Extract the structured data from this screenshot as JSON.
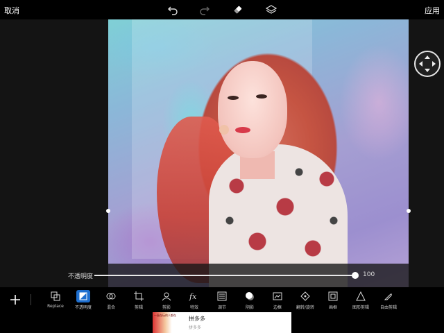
{
  "topbar": {
    "cancel_label": "取消",
    "apply_label": "应用",
    "icons": [
      "undo-icon",
      "redo-icon",
      "eraser-icon",
      "layers-icon"
    ]
  },
  "slider": {
    "label": "不透明度",
    "value": "100",
    "fraction": 1.0
  },
  "toolbar": {
    "add_icon": "plus-icon",
    "tools": [
      {
        "label": "Replace",
        "icon": "replace-icon",
        "active": false
      },
      {
        "label": "不透明度",
        "icon": "opacity-icon",
        "active": true
      },
      {
        "label": "混合",
        "icon": "blend-icon",
        "active": false
      },
      {
        "label": "剪辑",
        "icon": "crop-icon",
        "active": false
      },
      {
        "label": "剪影",
        "icon": "silhouette-icon",
        "active": false
      },
      {
        "label": "特效",
        "icon": "fx-icon",
        "active": false
      },
      {
        "label": "调节",
        "icon": "adjust-icon",
        "active": false
      },
      {
        "label": "阴影",
        "icon": "shadow-icon",
        "active": false
      },
      {
        "label": "边框",
        "icon": "border-icon",
        "active": false
      },
      {
        "label": "翻转/旋转",
        "icon": "flip-rotate-icon",
        "active": false
      },
      {
        "label": "画框",
        "icon": "frame-icon",
        "active": false
      },
      {
        "label": "图形剪辑",
        "icon": "shape-crop-icon",
        "active": false
      },
      {
        "label": "自由剪辑",
        "icon": "free-crop-icon",
        "active": false
      }
    ]
  },
  "ad": {
    "thumb_text": "一直在玩的人都在",
    "title": "拼多多",
    "subtitle": "拼多多"
  },
  "colors": {
    "accent": "#1e6fcf",
    "background": "#000000"
  }
}
